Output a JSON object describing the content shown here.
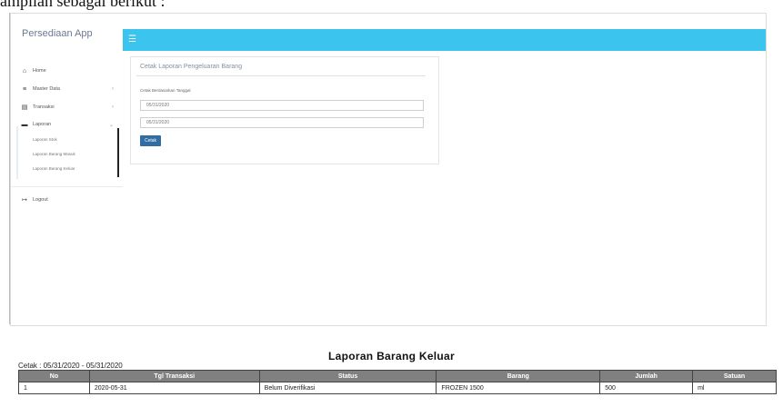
{
  "doc_heading": "ampilan sebagai berikut :",
  "app": {
    "brand": "Persediaan App"
  },
  "sidebar": {
    "items": [
      {
        "label": "Home",
        "icon": "home-icon"
      },
      {
        "label": "Master Data",
        "icon": "list-icon"
      },
      {
        "label": "Transaksi",
        "icon": "database-icon"
      },
      {
        "label": "Laporan",
        "icon": "folder-icon"
      },
      {
        "label": "Logout",
        "icon": "logout-icon"
      }
    ],
    "sub_items": [
      "Laporan Stok",
      "Laporan Barang Masuk",
      "Laporan Barang Keluar"
    ]
  },
  "card": {
    "title": "Cetak Laporan Pengeluaran Barang",
    "label": "Cetak Berdasarkan Tanggal",
    "date_from": "05/31/2020",
    "date_to": "05/31/2020",
    "button": "Cetak"
  },
  "report": {
    "title": "Laporan Barang Keluar",
    "cetak_text": "Cetak : 05/31/2020 - 05/31/2020",
    "columns": [
      "No",
      "Tgl Transaksi",
      "Status",
      "Barang",
      "Jumlah",
      "Satuan"
    ],
    "rows": [
      [
        "1",
        "2020-05-31",
        "Belum Diverifikasi",
        "FROZEN 1500",
        "500",
        "ml"
      ]
    ]
  },
  "colors": {
    "topbar": "#3bc4ee",
    "button": "#2f6da3",
    "table_header": "#808080"
  }
}
